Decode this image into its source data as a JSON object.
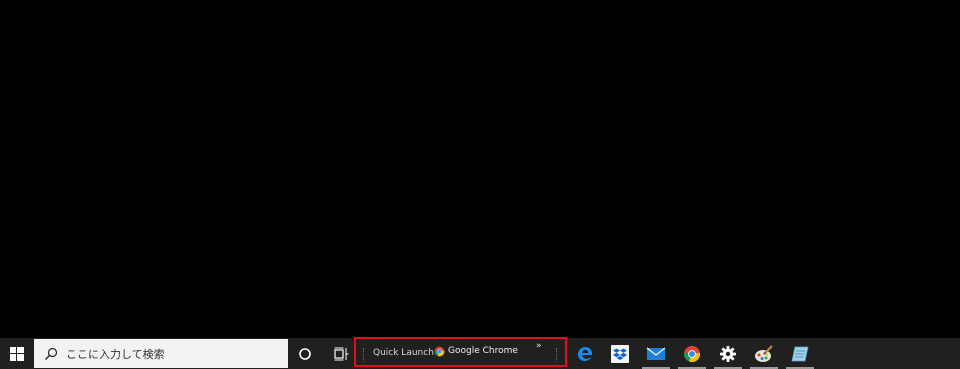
{
  "taskbar": {
    "search": {
      "placeholder": "ここに入力して検索",
      "icon": "search-icon"
    },
    "quick_launch": {
      "label": "Quick Launch",
      "item_label": "Google Chrome",
      "overflow_label": "»",
      "highlight_color": "#e0101a"
    },
    "pinned_apps": [
      {
        "name": "edge",
        "icon": "edge-icon",
        "running": false
      },
      {
        "name": "dropbox",
        "icon": "dropbox-icon",
        "running": false
      },
      {
        "name": "mail",
        "icon": "mail-icon",
        "running": true
      },
      {
        "name": "chrome",
        "icon": "chrome-icon",
        "running": true
      },
      {
        "name": "settings",
        "icon": "gear-icon",
        "running": true
      },
      {
        "name": "paint",
        "icon": "paint-icon",
        "running": true
      },
      {
        "name": "notepad",
        "icon": "notepad-icon",
        "running": true
      }
    ],
    "colors": {
      "taskbar_bg": "#202020",
      "desktop_bg": "#000000",
      "search_bg": "#f2f2f2"
    }
  }
}
